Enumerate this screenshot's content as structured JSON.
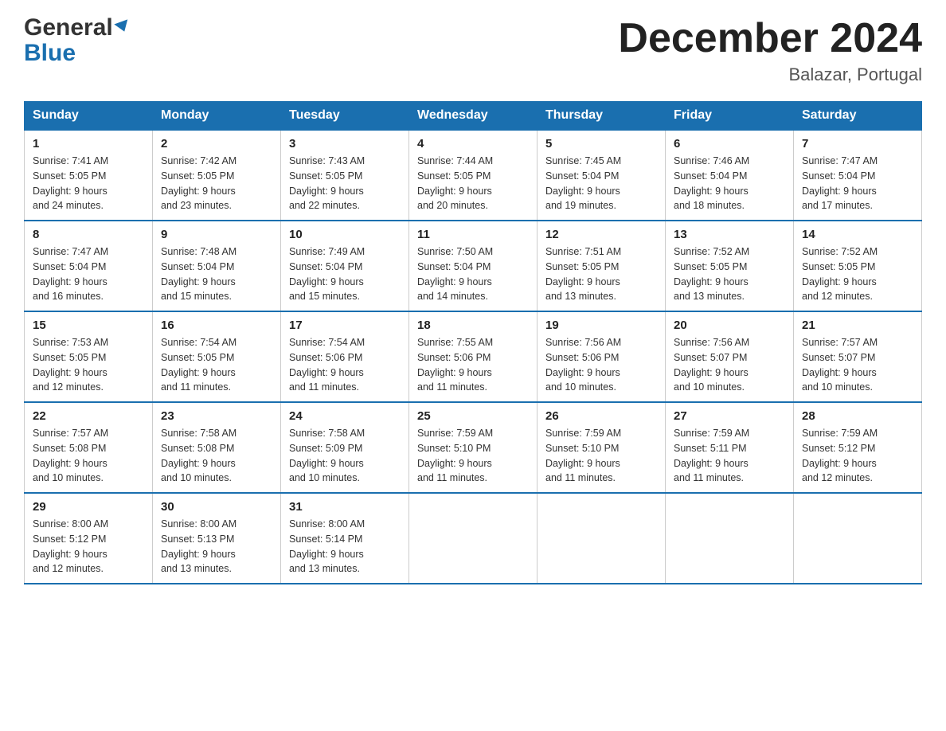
{
  "header": {
    "logo_general": "General",
    "logo_blue": "Blue",
    "month_title": "December 2024",
    "location": "Balazar, Portugal"
  },
  "days_of_week": [
    "Sunday",
    "Monday",
    "Tuesday",
    "Wednesday",
    "Thursday",
    "Friday",
    "Saturday"
  ],
  "weeks": [
    [
      {
        "day": "1",
        "sunrise": "7:41 AM",
        "sunset": "5:05 PM",
        "daylight": "9 hours and 24 minutes."
      },
      {
        "day": "2",
        "sunrise": "7:42 AM",
        "sunset": "5:05 PM",
        "daylight": "9 hours and 23 minutes."
      },
      {
        "day": "3",
        "sunrise": "7:43 AM",
        "sunset": "5:05 PM",
        "daylight": "9 hours and 22 minutes."
      },
      {
        "day": "4",
        "sunrise": "7:44 AM",
        "sunset": "5:05 PM",
        "daylight": "9 hours and 20 minutes."
      },
      {
        "day": "5",
        "sunrise": "7:45 AM",
        "sunset": "5:04 PM",
        "daylight": "9 hours and 19 minutes."
      },
      {
        "day": "6",
        "sunrise": "7:46 AM",
        "sunset": "5:04 PM",
        "daylight": "9 hours and 18 minutes."
      },
      {
        "day": "7",
        "sunrise": "7:47 AM",
        "sunset": "5:04 PM",
        "daylight": "9 hours and 17 minutes."
      }
    ],
    [
      {
        "day": "8",
        "sunrise": "7:47 AM",
        "sunset": "5:04 PM",
        "daylight": "9 hours and 16 minutes."
      },
      {
        "day": "9",
        "sunrise": "7:48 AM",
        "sunset": "5:04 PM",
        "daylight": "9 hours and 15 minutes."
      },
      {
        "day": "10",
        "sunrise": "7:49 AM",
        "sunset": "5:04 PM",
        "daylight": "9 hours and 15 minutes."
      },
      {
        "day": "11",
        "sunrise": "7:50 AM",
        "sunset": "5:04 PM",
        "daylight": "9 hours and 14 minutes."
      },
      {
        "day": "12",
        "sunrise": "7:51 AM",
        "sunset": "5:05 PM",
        "daylight": "9 hours and 13 minutes."
      },
      {
        "day": "13",
        "sunrise": "7:52 AM",
        "sunset": "5:05 PM",
        "daylight": "9 hours and 13 minutes."
      },
      {
        "day": "14",
        "sunrise": "7:52 AM",
        "sunset": "5:05 PM",
        "daylight": "9 hours and 12 minutes."
      }
    ],
    [
      {
        "day": "15",
        "sunrise": "7:53 AM",
        "sunset": "5:05 PM",
        "daylight": "9 hours and 12 minutes."
      },
      {
        "day": "16",
        "sunrise": "7:54 AM",
        "sunset": "5:05 PM",
        "daylight": "9 hours and 11 minutes."
      },
      {
        "day": "17",
        "sunrise": "7:54 AM",
        "sunset": "5:06 PM",
        "daylight": "9 hours and 11 minutes."
      },
      {
        "day": "18",
        "sunrise": "7:55 AM",
        "sunset": "5:06 PM",
        "daylight": "9 hours and 11 minutes."
      },
      {
        "day": "19",
        "sunrise": "7:56 AM",
        "sunset": "5:06 PM",
        "daylight": "9 hours and 10 minutes."
      },
      {
        "day": "20",
        "sunrise": "7:56 AM",
        "sunset": "5:07 PM",
        "daylight": "9 hours and 10 minutes."
      },
      {
        "day": "21",
        "sunrise": "7:57 AM",
        "sunset": "5:07 PM",
        "daylight": "9 hours and 10 minutes."
      }
    ],
    [
      {
        "day": "22",
        "sunrise": "7:57 AM",
        "sunset": "5:08 PM",
        "daylight": "9 hours and 10 minutes."
      },
      {
        "day": "23",
        "sunrise": "7:58 AM",
        "sunset": "5:08 PM",
        "daylight": "9 hours and 10 minutes."
      },
      {
        "day": "24",
        "sunrise": "7:58 AM",
        "sunset": "5:09 PM",
        "daylight": "9 hours and 10 minutes."
      },
      {
        "day": "25",
        "sunrise": "7:59 AM",
        "sunset": "5:10 PM",
        "daylight": "9 hours and 11 minutes."
      },
      {
        "day": "26",
        "sunrise": "7:59 AM",
        "sunset": "5:10 PM",
        "daylight": "9 hours and 11 minutes."
      },
      {
        "day": "27",
        "sunrise": "7:59 AM",
        "sunset": "5:11 PM",
        "daylight": "9 hours and 11 minutes."
      },
      {
        "day": "28",
        "sunrise": "7:59 AM",
        "sunset": "5:12 PM",
        "daylight": "9 hours and 12 minutes."
      }
    ],
    [
      {
        "day": "29",
        "sunrise": "8:00 AM",
        "sunset": "5:12 PM",
        "daylight": "9 hours and 12 minutes."
      },
      {
        "day": "30",
        "sunrise": "8:00 AM",
        "sunset": "5:13 PM",
        "daylight": "9 hours and 13 minutes."
      },
      {
        "day": "31",
        "sunrise": "8:00 AM",
        "sunset": "5:14 PM",
        "daylight": "9 hours and 13 minutes."
      },
      null,
      null,
      null,
      null
    ]
  ],
  "labels": {
    "sunrise": "Sunrise:",
    "sunset": "Sunset:",
    "daylight": "Daylight:"
  }
}
